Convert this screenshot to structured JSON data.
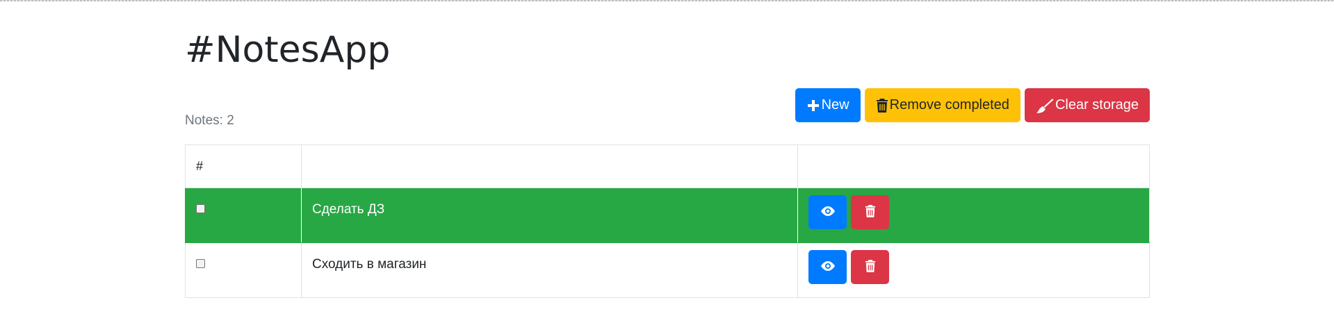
{
  "app": {
    "title": "#NotesApp"
  },
  "counter": {
    "text": "Notes: 2"
  },
  "toolbar": {
    "new_label": "New",
    "remove_completed_label": "Remove completed",
    "clear_storage_label": "Clear storage"
  },
  "table": {
    "headers": [
      "#",
      "",
      ""
    ],
    "rows": [
      {
        "title": "Сделать ДЗ",
        "completed": true
      },
      {
        "title": "Сходить в магазин",
        "completed": false
      }
    ]
  },
  "colors": {
    "primary": "#007bff",
    "warning": "#ffc107",
    "danger": "#dc3545",
    "success": "#28a745"
  },
  "icons": {
    "new": "plus-icon",
    "remove_completed": "trash-icon",
    "clear_storage": "broom-icon",
    "view": "eye-icon",
    "delete": "trash-icon"
  }
}
